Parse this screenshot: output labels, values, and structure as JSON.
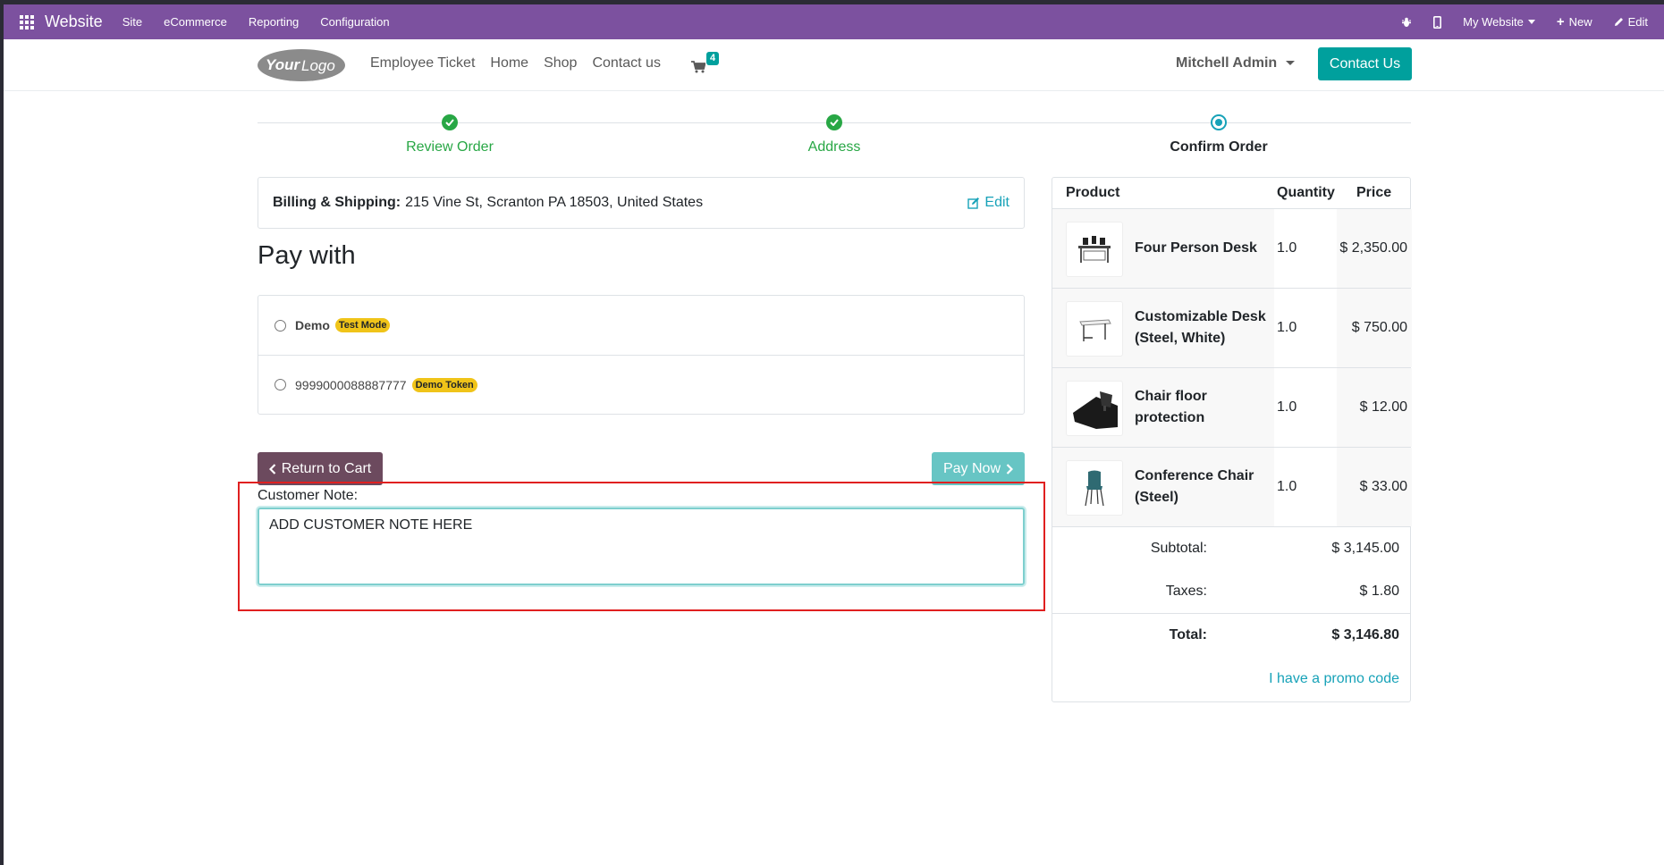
{
  "topbar": {
    "brand": "Website",
    "menu": [
      "Site",
      "eCommerce",
      "Reporting",
      "Configuration"
    ],
    "website_switch": "My Website",
    "new_label": "New",
    "edit_label": "Edit"
  },
  "header": {
    "logo_text": "YourLogo",
    "nav": [
      "Employee Ticket",
      "Home",
      "Shop",
      "Contact us"
    ],
    "cart_count": "4",
    "user": "Mitchell Admin",
    "contact_button": "Contact Us"
  },
  "wizard": {
    "steps": [
      {
        "label": "Review Order",
        "state": "done"
      },
      {
        "label": "Address",
        "state": "done"
      },
      {
        "label": "Confirm Order",
        "state": "current"
      }
    ]
  },
  "billing": {
    "label": "Billing & Shipping:",
    "address": "215 Vine St, Scranton PA 18503, United States",
    "edit": "Edit"
  },
  "payment": {
    "title": "Pay with",
    "methods": [
      {
        "name": "Demo",
        "tag": "Test Mode"
      },
      {
        "name": "9999000088887777",
        "tag": "Demo Token"
      }
    ],
    "return_button": "Return to Cart",
    "pay_button": "Pay Now"
  },
  "note": {
    "label": "Customer Note:",
    "value": "ADD CUSTOMER NOTE HERE"
  },
  "summary": {
    "headers": {
      "product": "Product",
      "quantity": "Quantity",
      "price": "Price"
    },
    "lines": [
      {
        "name": "Four Person Desk",
        "qty": "1.0",
        "price": "$ 2,350.00",
        "icon": "desk-icon"
      },
      {
        "name": "Customizable Desk (Steel, White)",
        "qty": "1.0",
        "price": "$ 750.00",
        "icon": "desk-white-icon"
      },
      {
        "name": "Chair floor protection",
        "qty": "1.0",
        "price": "$ 12.00",
        "icon": "floor-mat-icon"
      },
      {
        "name": "Conference Chair (Steel)",
        "qty": "1.0",
        "price": "$ 33.00",
        "icon": "chair-icon"
      }
    ],
    "subtotal_label": "Subtotal:",
    "subtotal": "$ 3,145.00",
    "taxes_label": "Taxes:",
    "taxes": "$ 1.80",
    "total_label": "Total:",
    "total": "$ 3,146.80",
    "promo": "I have a promo code"
  },
  "colors": {
    "topbar": "#7c519f",
    "primary": "#00a09d",
    "success": "#28a745",
    "highlight": "#e02020"
  }
}
